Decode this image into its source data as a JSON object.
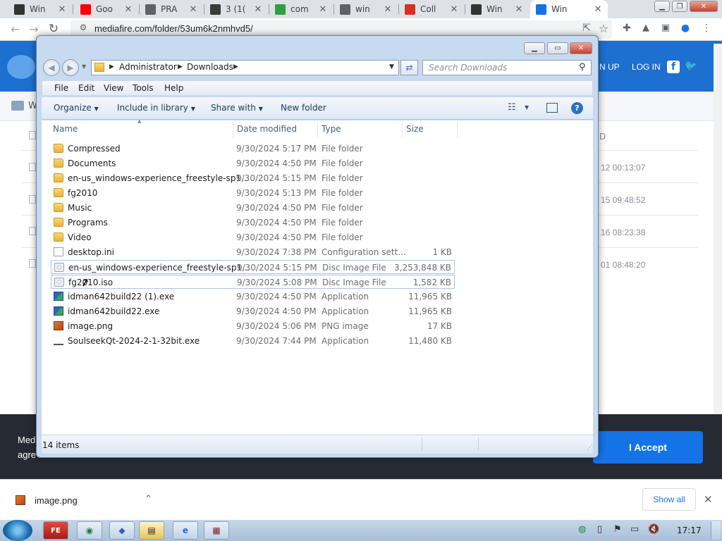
{
  "browser": {
    "tabs": [
      {
        "label": "Win",
        "icon": "wikipedia-icon",
        "color": "#333333"
      },
      {
        "label": "Goo",
        "icon": "youtube-icon",
        "color": "#ff0000"
      },
      {
        "label": "PRA",
        "icon": "globe-icon",
        "color": "#5f6368"
      },
      {
        "label": "3 (1(",
        "icon": "video-thumbnail-icon",
        "color": "#3a3a3a"
      },
      {
        "label": "com",
        "icon": "ocx-icon",
        "color": "#2f9e44"
      },
      {
        "label": "win",
        "icon": "globe-icon",
        "color": "#5f6368"
      },
      {
        "label": "Coll",
        "icon": "puzzle-red-icon",
        "color": "#d93025"
      },
      {
        "label": "Win",
        "icon": "wikipedia-icon",
        "color": "#333333"
      },
      {
        "label": "Win",
        "icon": "mediafire-icon",
        "color": "#1473e6"
      }
    ],
    "url": "mediafire.com/folder/53um6k2nmhvd5/"
  },
  "mediafire": {
    "signup_label": "N UP",
    "login_label": "LOG IN",
    "breadcrumb_partial": "W",
    "column_partial": "D",
    "rows": [
      {
        "date": "12 00:13:07"
      },
      {
        "date": "15 09:48:52"
      },
      {
        "date": "16 08:23:38"
      },
      {
        "date": "01 08:48:20"
      }
    ],
    "consent_partial_1": "Med",
    "consent_partial_2": "agre",
    "accept_label": "I Accept"
  },
  "explorer": {
    "breadcrumb": [
      "Administrator",
      "Downloads"
    ],
    "search_placeholder": "Search Downloads",
    "menu": [
      "File",
      "Edit",
      "View",
      "Tools",
      "Help"
    ],
    "commands": [
      "Organize",
      "Include in library",
      "Share with",
      "New folder"
    ],
    "columns": [
      "Name",
      "Date modified",
      "Type",
      "Size"
    ],
    "files": [
      {
        "name": "Compressed",
        "date": "9/30/2024 5:17 PM",
        "type": "File folder",
        "size": "",
        "icon": "folder-icon"
      },
      {
        "name": "Documents",
        "date": "9/30/2024 4:50 PM",
        "type": "File folder",
        "size": "",
        "icon": "folder-icon"
      },
      {
        "name": "en-us_windows-experience_freestyle-sp1...",
        "date": "9/30/2024 5:15 PM",
        "type": "File folder",
        "size": "",
        "icon": "folder-icon"
      },
      {
        "name": "fg2010",
        "date": "9/30/2024 5:13 PM",
        "type": "File folder",
        "size": "",
        "icon": "folder-icon"
      },
      {
        "name": "Music",
        "date": "9/30/2024 4:50 PM",
        "type": "File folder",
        "size": "",
        "icon": "folder-icon"
      },
      {
        "name": "Programs",
        "date": "9/30/2024 4:50 PM",
        "type": "File folder",
        "size": "",
        "icon": "folder-icon"
      },
      {
        "name": "Video",
        "date": "9/30/2024 4:50 PM",
        "type": "File folder",
        "size": "",
        "icon": "folder-icon"
      },
      {
        "name": "desktop.ini",
        "date": "9/30/2024 7:38 PM",
        "type": "Configuration sett...",
        "size": "1 KB",
        "icon": "config-file-icon"
      },
      {
        "name": "en-us_windows-experience_freestyle-sp1...",
        "date": "9/30/2024 5:15 PM",
        "type": "Disc Image File",
        "size": "3,253,848 KB",
        "icon": "disc-image-icon"
      },
      {
        "name": "fg2010.iso",
        "date": "9/30/2024 5:08 PM",
        "type": "Disc Image File",
        "size": "1,582 KB",
        "icon": "disc-image-icon"
      },
      {
        "name": "idman642build22 (1).exe",
        "date": "9/30/2024 4:50 PM",
        "type": "Application",
        "size": "11,965 KB",
        "icon": "exe-app-icon"
      },
      {
        "name": "idman642build22.exe",
        "date": "9/30/2024 4:50 PM",
        "type": "Application",
        "size": "11,965 KB",
        "icon": "exe-app-icon"
      },
      {
        "name": "image.png",
        "date": "9/30/2024 5:06 PM",
        "type": "PNG image",
        "size": "17 KB",
        "icon": "png-image-icon"
      },
      {
        "name": "SoulseekQt-2024-2-1-32bit.exe",
        "date": "9/30/2024 7:44 PM",
        "type": "Application",
        "size": "11,480 KB",
        "icon": "installer-icon"
      }
    ],
    "status": "14 items"
  },
  "download_shelf": {
    "file": "image.png",
    "show_all": "Show all"
  },
  "taskbar": {
    "clock": "17:17"
  }
}
